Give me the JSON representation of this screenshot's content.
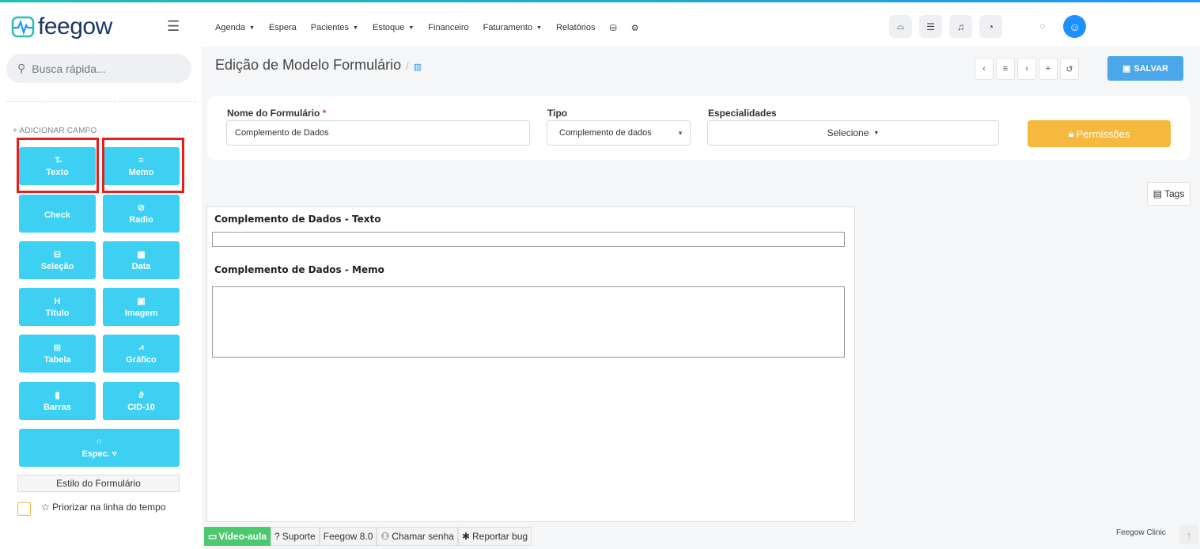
{
  "app": {
    "name": "feegow"
  },
  "sidebar": {
    "search_placeholder": "Busca rápida...",
    "add_field_label": "+ ADICIONAR CAMPO",
    "field_buttons": [
      {
        "label": "Texto",
        "icon": "text-icon"
      },
      {
        "label": "Memo",
        "icon": "lines-icon"
      },
      {
        "label": "Check",
        "icon": ""
      },
      {
        "label": "Radio",
        "icon": "radio-check-icon"
      },
      {
        "label": "Seleção",
        "icon": "select-box-icon"
      },
      {
        "label": "Data",
        "icon": "calendar-icon"
      },
      {
        "label": "Título",
        "icon": "heading-icon"
      },
      {
        "label": "Imagem",
        "icon": "image-icon"
      },
      {
        "label": "Tabela",
        "icon": "table-icon"
      },
      {
        "label": "Gráfico",
        "icon": "chart-icon"
      },
      {
        "label": "Barras",
        "icon": "barcode-icon"
      },
      {
        "label": "CID-10",
        "icon": "stethoscope-icon"
      },
      {
        "label": "Espec. ▿",
        "icon": "headphones-icon"
      }
    ],
    "style_button": "Estilo do Formulário",
    "prioritize_label": "☆ Priorizar na linha do tempo"
  },
  "nav": {
    "items": [
      {
        "label": "Agenda",
        "caret": true
      },
      {
        "label": "Espera",
        "caret": false
      },
      {
        "label": "Pacientes",
        "caret": true
      },
      {
        "label": "Estoque",
        "caret": true
      },
      {
        "label": "Financeiro",
        "caret": false
      },
      {
        "label": "Faturamento",
        "caret": true
      },
      {
        "label": "Relatórios",
        "caret": false
      }
    ]
  },
  "header": {
    "title": "Edição de Modelo Formulário",
    "separator": "/",
    "save_label": "SALVAR"
  },
  "form": {
    "name_label": "Nome do Formulário",
    "name_required": "*",
    "name_value": "Complemento de Dados",
    "type_label": "Tipo",
    "type_value": "Complemento de dados",
    "specialties_label": "Especialidades",
    "specialties_value": "Selecione",
    "permissions_label": "Permissões"
  },
  "tags_label": "Tags",
  "canvas": {
    "fields": [
      {
        "title": "Complemento de Dados - Texto"
      },
      {
        "title": "Complemento de Dados - Memo"
      }
    ]
  },
  "footer": {
    "video": "Vídeo-aula",
    "support": "Suporte",
    "version": "Feegow 8.0",
    "call": "Chamar senha",
    "bug": "Reportar bug",
    "clinic": "Feegow Clinic"
  },
  "colors": {
    "accent": "#3dd0f2",
    "save": "#49a7ea",
    "permissions": "#f5b93e",
    "highlight": "#e81c1c"
  }
}
